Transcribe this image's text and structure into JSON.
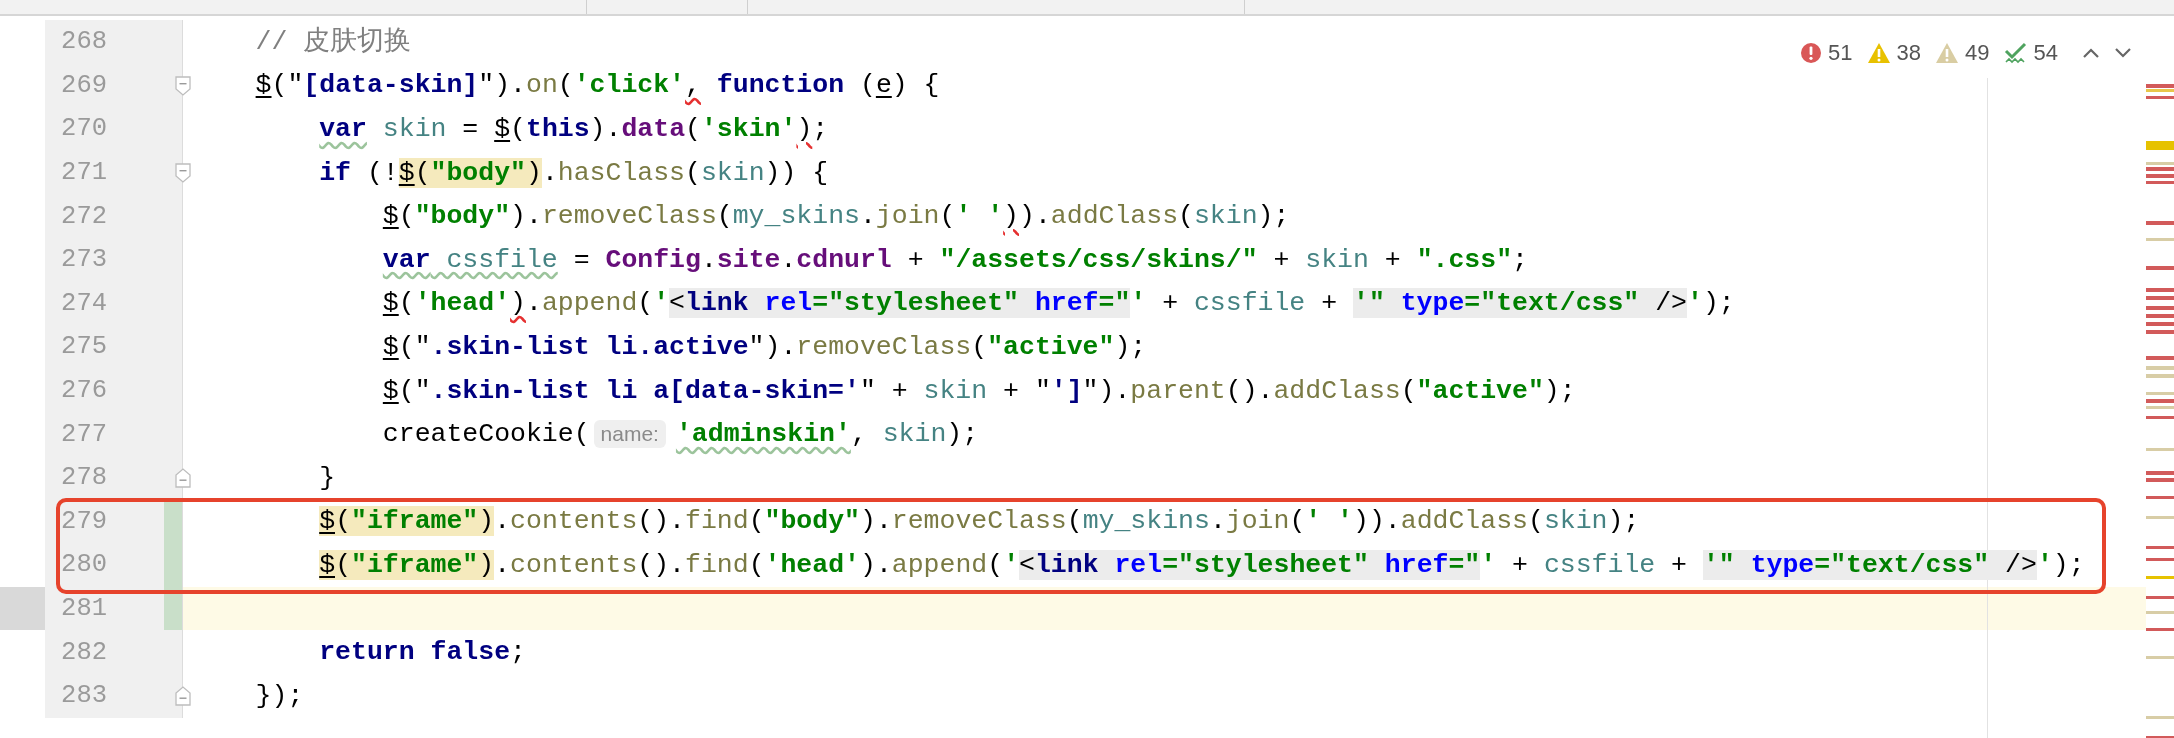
{
  "inspections": [
    {
      "kind": "error",
      "count": "51"
    },
    {
      "kind": "warning",
      "count": "38"
    },
    {
      "kind": "weak-warning",
      "count": "49"
    },
    {
      "kind": "typo",
      "count": "54"
    }
  ],
  "lines": [
    {
      "number": "268",
      "tokens": [
        {
          "text": "// 皮肤切换",
          "kind": "comment"
        }
      ]
    },
    {
      "number": "269",
      "fold_start": true,
      "tokens": [
        {
          "text": "$",
          "kind": "plain",
          "linked": true
        },
        {
          "text": "(\"",
          "kind": "plain"
        },
        {
          "text": "[data-skin]",
          "kind": "selector"
        },
        {
          "text": "\").",
          "kind": "plain"
        },
        {
          "text": "on",
          "kind": "func"
        },
        {
          "text": "(",
          "kind": "plain"
        },
        {
          "text": "'click'",
          "kind": "string"
        },
        {
          "text": ",",
          "kind": "plain",
          "error": true
        },
        {
          "text": " function",
          "kind": "keyword"
        },
        {
          "text": " (",
          "kind": "plain"
        },
        {
          "text": "e",
          "kind": "plain",
          "linked": true
        },
        {
          "text": ") {",
          "kind": "plain"
        }
      ],
      "children": [
        {
          "number": "270",
          "tokens": [
            {
              "text": "var",
              "kind": "keyword",
              "typo": true
            },
            {
              "text": " skin",
              "kind": "variable"
            },
            {
              "text": " = ",
              "kind": "plain"
            },
            {
              "text": "$",
              "kind": "plain",
              "linked": true
            },
            {
              "text": "(",
              "kind": "plain"
            },
            {
              "text": "this",
              "kind": "keyword"
            },
            {
              "text": ").",
              "kind": "plain"
            },
            {
              "text": "data",
              "kind": "field"
            },
            {
              "text": "(",
              "kind": "plain"
            },
            {
              "text": "'skin'",
              "kind": "string"
            },
            {
              "text": ")",
              "kind": "plain",
              "error": true
            },
            {
              "text": ";",
              "kind": "plain"
            }
          ]
        },
        {
          "number": "271",
          "fold_start": true,
          "tokens": [
            {
              "text": "if",
              "kind": "keyword"
            },
            {
              "text": " (!",
              "kind": "plain"
            },
            {
              "text": "$",
              "kind": "plain",
              "linked": true,
              "usage": true
            },
            {
              "text": "(",
              "kind": "plain",
              "usage": true
            },
            {
              "text": "\"body\"",
              "kind": "string",
              "usage": true
            },
            {
              "text": ")",
              "kind": "plain",
              "usage": true
            },
            {
              "text": ".",
              "kind": "plain"
            },
            {
              "text": "hasClass",
              "kind": "func"
            },
            {
              "text": "(",
              "kind": "plain"
            },
            {
              "text": "skin",
              "kind": "variable"
            },
            {
              "text": ")) {",
              "kind": "plain"
            }
          ],
          "children": [
            {
              "number": "272",
              "tokens": [
                {
                  "text": "$",
                  "kind": "plain",
                  "linked": true
                },
                {
                  "text": "(",
                  "kind": "plain"
                },
                {
                  "text": "\"body\"",
                  "kind": "string"
                },
                {
                  "text": ").",
                  "kind": "plain"
                },
                {
                  "text": "removeClass",
                  "kind": "func"
                },
                {
                  "text": "(",
                  "kind": "plain"
                },
                {
                  "text": "my_skins",
                  "kind": "variable"
                },
                {
                  "text": ".",
                  "kind": "plain"
                },
                {
                  "text": "join",
                  "kind": "func"
                },
                {
                  "text": "(",
                  "kind": "plain"
                },
                {
                  "text": "' '",
                  "kind": "string"
                },
                {
                  "text": ")",
                  "kind": "plain",
                  "error": true
                },
                {
                  "text": ").",
                  "kind": "plain"
                },
                {
                  "text": "addClass",
                  "kind": "func"
                },
                {
                  "text": "(",
                  "kind": "plain"
                },
                {
                  "text": "skin",
                  "kind": "variable"
                },
                {
                  "text": ");",
                  "kind": "plain"
                }
              ]
            },
            {
              "number": "273",
              "tokens": [
                {
                  "text": "var",
                  "kind": "keyword",
                  "typo": true
                },
                {
                  "text": " cssfile",
                  "kind": "variable",
                  "typo": true
                },
                {
                  "text": " = ",
                  "kind": "plain"
                },
                {
                  "text": "Config",
                  "kind": "field"
                },
                {
                  "text": ".",
                  "kind": "plain"
                },
                {
                  "text": "site",
                  "kind": "field"
                },
                {
                  "text": ".",
                  "kind": "plain"
                },
                {
                  "text": "cdnurl",
                  "kind": "field"
                },
                {
                  "text": " + ",
                  "kind": "plain"
                },
                {
                  "text": "\"/assets/css/skins/\"",
                  "kind": "string"
                },
                {
                  "text": " + ",
                  "kind": "plain"
                },
                {
                  "text": "skin",
                  "kind": "variable"
                },
                {
                  "text": " + ",
                  "kind": "plain"
                },
                {
                  "text": "\".css\"",
                  "kind": "string"
                },
                {
                  "text": ";",
                  "kind": "plain"
                }
              ]
            },
            {
              "number": "274",
              "tokens": [
                {
                  "text": "$",
                  "kind": "plain",
                  "linked": true
                },
                {
                  "text": "(",
                  "kind": "plain"
                },
                {
                  "text": "'head'",
                  "kind": "string"
                },
                {
                  "text": ")",
                  "kind": "plain",
                  "error": true
                },
                {
                  "text": ".",
                  "kind": "plain"
                },
                {
                  "text": "append",
                  "kind": "func"
                },
                {
                  "text": "(",
                  "kind": "plain"
                },
                {
                  "text": "'",
                  "kind": "string"
                },
                {
                  "text": "<",
                  "kind": "plain",
                  "injected": true
                },
                {
                  "text": "link",
                  "kind": "tag",
                  "injected": true
                },
                {
                  "text": " rel",
                  "kind": "attr",
                  "injected": true
                },
                {
                  "text": "=\"stylesheet\"",
                  "kind": "string",
                  "injected": true
                },
                {
                  "text": " href",
                  "kind": "attr",
                  "injected": true
                },
                {
                  "text": "=\"",
                  "kind": "string",
                  "injected": true
                },
                {
                  "text": "'",
                  "kind": "string"
                },
                {
                  "text": " + ",
                  "kind": "plain"
                },
                {
                  "text": "cssfile",
                  "kind": "variable"
                },
                {
                  "text": " + ",
                  "kind": "plain"
                },
                {
                  "text": "'\"",
                  "kind": "string",
                  "injected": true
                },
                {
                  "text": " type",
                  "kind": "attr",
                  "injected": true
                },
                {
                  "text": "=\"text/css\"",
                  "kind": "string",
                  "injected": true
                },
                {
                  "text": " />",
                  "kind": "plain",
                  "injected": true
                },
                {
                  "text": "'",
                  "kind": "string"
                },
                {
                  "text": ");",
                  "kind": "plain"
                }
              ]
            },
            {
              "number": "275",
              "tokens": [
                {
                  "text": "$",
                  "kind": "plain",
                  "linked": true
                },
                {
                  "text": "(\"",
                  "kind": "plain"
                },
                {
                  "text": ".skin-list li.active",
                  "kind": "selector"
                },
                {
                  "text": "\").",
                  "kind": "plain"
                },
                {
                  "text": "removeClass",
                  "kind": "func"
                },
                {
                  "text": "(",
                  "kind": "plain"
                },
                {
                  "text": "\"active\"",
                  "kind": "string"
                },
                {
                  "text": ");",
                  "kind": "plain"
                }
              ]
            },
            {
              "number": "276",
              "tokens": [
                {
                  "text": "$",
                  "kind": "plain",
                  "linked": true
                },
                {
                  "text": "(\"",
                  "kind": "plain"
                },
                {
                  "text": ".skin-list li a[data-skin='",
                  "kind": "selector"
                },
                {
                  "text": "\" + ",
                  "kind": "plain"
                },
                {
                  "text": "skin",
                  "kind": "variable"
                },
                {
                  "text": " + \"",
                  "kind": "plain"
                },
                {
                  "text": "']",
                  "kind": "selector"
                },
                {
                  "text": "\").",
                  "kind": "plain"
                },
                {
                  "text": "parent",
                  "kind": "func"
                },
                {
                  "text": "().",
                  "kind": "plain"
                },
                {
                  "text": "addClass",
                  "kind": "func"
                },
                {
                  "text": "(",
                  "kind": "plain"
                },
                {
                  "text": "\"active\"",
                  "kind": "string"
                },
                {
                  "text": ");",
                  "kind": "plain"
                }
              ]
            },
            {
              "number": "277",
              "tokens": [
                {
                  "text": "createCookie(",
                  "kind": "plain"
                },
                {
                  "text": "name:",
                  "kind": "hint"
                },
                {
                  "text": "'adminskin'",
                  "kind": "string",
                  "typo": true
                },
                {
                  "text": ", ",
                  "kind": "plain"
                },
                {
                  "text": "skin",
                  "kind": "variable"
                },
                {
                  "text": ");",
                  "kind": "plain"
                }
              ]
            }
          ]
        },
        {
          "number": "278",
          "fold_end": true,
          "tokens": [
            {
              "text": "}",
              "kind": "plain"
            }
          ]
        },
        {
          "number": "279",
          "changed": true,
          "boxed": true,
          "tokens": [
            {
              "text": "$",
              "kind": "plain",
              "linked": true,
              "usage": true
            },
            {
              "text": "(",
              "kind": "plain",
              "usage": true
            },
            {
              "text": "\"iframe\"",
              "kind": "string",
              "usage": true
            },
            {
              "text": ")",
              "kind": "plain",
              "usage": true
            },
            {
              "text": ".",
              "kind": "plain"
            },
            {
              "text": "contents",
              "kind": "func"
            },
            {
              "text": "().",
              "kind": "plain"
            },
            {
              "text": "find",
              "kind": "func"
            },
            {
              "text": "(",
              "kind": "plain"
            },
            {
              "text": "\"body\"",
              "kind": "string"
            },
            {
              "text": ").",
              "kind": "plain"
            },
            {
              "text": "removeClass",
              "kind": "func"
            },
            {
              "text": "(",
              "kind": "plain"
            },
            {
              "text": "my_skins",
              "kind": "variable"
            },
            {
              "text": ".",
              "kind": "plain"
            },
            {
              "text": "join",
              "kind": "func"
            },
            {
              "text": "(",
              "kind": "plain"
            },
            {
              "text": "' '",
              "kind": "string"
            },
            {
              "text": ")).",
              "kind": "plain"
            },
            {
              "text": "addClass",
              "kind": "func"
            },
            {
              "text": "(",
              "kind": "plain"
            },
            {
              "text": "skin",
              "kind": "variable"
            },
            {
              "text": ");",
              "kind": "plain"
            }
          ]
        },
        {
          "number": "280",
          "changed": true,
          "boxed": true,
          "tokens": [
            {
              "text": "$",
              "kind": "plain",
              "linked": true,
              "usage": true
            },
            {
              "text": "(",
              "kind": "plain",
              "usage": true
            },
            {
              "text": "\"iframe\"",
              "kind": "string",
              "usage": true
            },
            {
              "text": ")",
              "kind": "plain",
              "usage": true
            },
            {
              "text": ".",
              "kind": "plain"
            },
            {
              "text": "contents",
              "kind": "func"
            },
            {
              "text": "().",
              "kind": "plain"
            },
            {
              "text": "find",
              "kind": "func"
            },
            {
              "text": "(",
              "kind": "plain"
            },
            {
              "text": "'head'",
              "kind": "string"
            },
            {
              "text": ").",
              "kind": "plain"
            },
            {
              "text": "append",
              "kind": "func"
            },
            {
              "text": "(",
              "kind": "plain"
            },
            {
              "text": "'",
              "kind": "string"
            },
            {
              "text": "<",
              "kind": "plain",
              "injected": true
            },
            {
              "text": "link",
              "kind": "tag",
              "injected": true
            },
            {
              "text": " rel",
              "kind": "attr",
              "injected": true
            },
            {
              "text": "=\"stylesheet\"",
              "kind": "string",
              "injected": true
            },
            {
              "text": " href",
              "kind": "attr",
              "injected": true
            },
            {
              "text": "=\"",
              "kind": "string",
              "injected": true
            },
            {
              "text": "'",
              "kind": "string"
            },
            {
              "text": " + ",
              "kind": "plain"
            },
            {
              "text": "cssfile",
              "kind": "variable"
            },
            {
              "text": " + ",
              "kind": "plain"
            },
            {
              "text": "'\"",
              "kind": "string",
              "injected": true
            },
            {
              "text": " type",
              "kind": "attr",
              "injected": true
            },
            {
              "text": "=\"text/css\"",
              "kind": "string",
              "injected": true
            },
            {
              "text": " />",
              "kind": "plain",
              "injected": true
            },
            {
              "text": "'",
              "kind": "string"
            },
            {
              "text": ");",
              "kind": "plain"
            }
          ]
        },
        {
          "number": "281",
          "changed": true,
          "current": true
        },
        {
          "number": "282",
          "tokens": [
            {
              "text": "return",
              "kind": "keyword"
            },
            {
              "text": " false",
              "kind": "keyword"
            },
            {
              "text": ";",
              "kind": "plain"
            }
          ]
        }
      ]
    },
    {
      "number": "283",
      "fold_end": true,
      "tokens": [
        {
          "text": "});",
          "kind": "plain"
        }
      ]
    }
  ]
}
